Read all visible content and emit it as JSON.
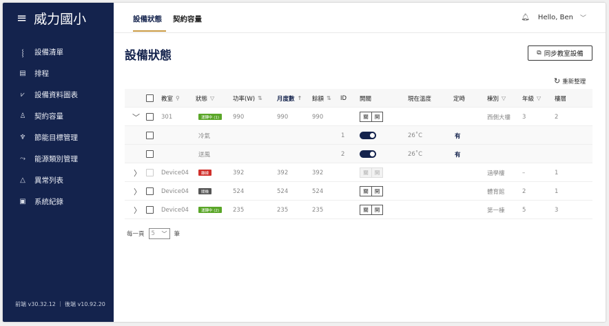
{
  "app": {
    "brand": "威力國小",
    "version": "前端 v30.32.12 ｜ 後端 v10.92.20"
  },
  "sidebar": {
    "items": [
      {
        "label": "設備清單",
        "icon": "device-list-icon",
        "glyph": "⸾"
      },
      {
        "label": "排程",
        "icon": "schedule-icon",
        "glyph": "▤"
      },
      {
        "label": "設備資料圖表",
        "icon": "chart-icon",
        "glyph": "⩗"
      },
      {
        "label": "契約容量",
        "icon": "contract-icon",
        "glyph": "♙"
      },
      {
        "label": "節能目標管理",
        "icon": "target-icon",
        "glyph": "♆"
      },
      {
        "label": "能源類別管理",
        "icon": "energy-icon",
        "glyph": "⤳"
      },
      {
        "label": "異常列表",
        "icon": "warning-icon",
        "glyph": "△"
      },
      {
        "label": "系統紀錄",
        "icon": "log-icon",
        "glyph": "▣"
      }
    ]
  },
  "header": {
    "tabs": [
      "設備狀態",
      "契約容量"
    ],
    "greeting": "Hello, Ben"
  },
  "main": {
    "title": "設備狀態",
    "sync_label": "同步教室設備",
    "refresh_label": "重新整理",
    "columns": [
      "教室",
      "狀態",
      "功率(W)",
      "月度數",
      "餘額",
      "ID",
      "開關",
      "現在溫度",
      "定時",
      "棟別",
      "年級",
      "樓層"
    ],
    "switch_labels": {
      "off": "關",
      "on": "開"
    },
    "rows": [
      {
        "room": "301",
        "status": "運轉中 (1)",
        "power": "990",
        "monthly": "990",
        "balance": "990",
        "building": "西側大樓",
        "grade": "3",
        "floor": "2"
      },
      {
        "name": "冷氣",
        "id": "1",
        "temp": "26˚C",
        "timer": "有"
      },
      {
        "name": "送風",
        "id": "2",
        "temp": "26˚C",
        "timer": "有"
      },
      {
        "room": "Device04",
        "status": "離線",
        "power": "392",
        "monthly": "392",
        "balance": "392",
        "building": "涵學樓",
        "grade": "–",
        "floor": "1"
      },
      {
        "room": "Device04",
        "status": "關機",
        "power": "524",
        "monthly": "524",
        "balance": "524",
        "building": "體育館",
        "grade": "2",
        "floor": "1"
      },
      {
        "room": "Device04",
        "status": "運轉中 (2)",
        "power": "235",
        "monthly": "235",
        "balance": "235",
        "building": "第一棟",
        "grade": "5",
        "floor": "3"
      }
    ],
    "pager": {
      "prefix": "每一頁",
      "value": "5",
      "suffix": "筆"
    }
  },
  "colors": {
    "navy": "#14234d",
    "accent": "#c99a44",
    "running": "#5aa628",
    "offline": "#d0302b",
    "off": "#555555"
  }
}
